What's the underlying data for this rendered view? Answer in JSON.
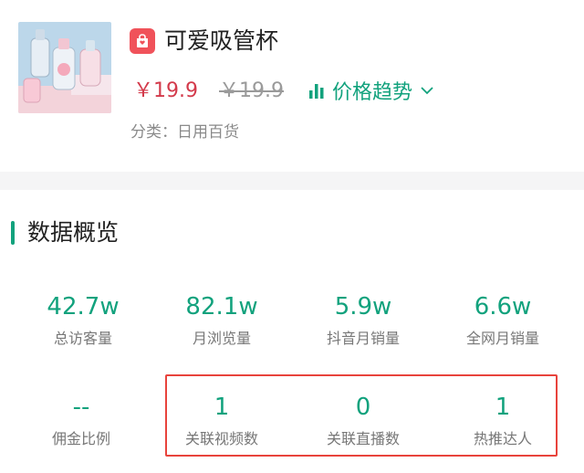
{
  "product": {
    "title": "可爱吸管杯",
    "price": "￥19.9",
    "original_price": "￥19.9",
    "trend_label": "价格趋势",
    "category": "分类：日用百货",
    "icons": {
      "shop": "shopping-bag-icon",
      "trend": "bar-chart-icon",
      "expand": "chevron-down-icon"
    }
  },
  "overview": {
    "title": "数据概览",
    "stats": [
      {
        "value": "42.7w",
        "label": "总访客量"
      },
      {
        "value": "82.1w",
        "label": "月浏览量"
      },
      {
        "value": "5.9w",
        "label": "抖音月销量"
      },
      {
        "value": "6.6w",
        "label": "全网月销量"
      },
      {
        "value": "--",
        "label": "佣金比例"
      },
      {
        "value": "1",
        "label": "关联视频数"
      },
      {
        "value": "0",
        "label": "关联直播数"
      },
      {
        "value": "1",
        "label": "热推达人"
      }
    ]
  },
  "colors": {
    "accent": "#12a27d",
    "price": "#d33a4b",
    "highlight": "#e8433c",
    "badge": "#f0525a"
  }
}
